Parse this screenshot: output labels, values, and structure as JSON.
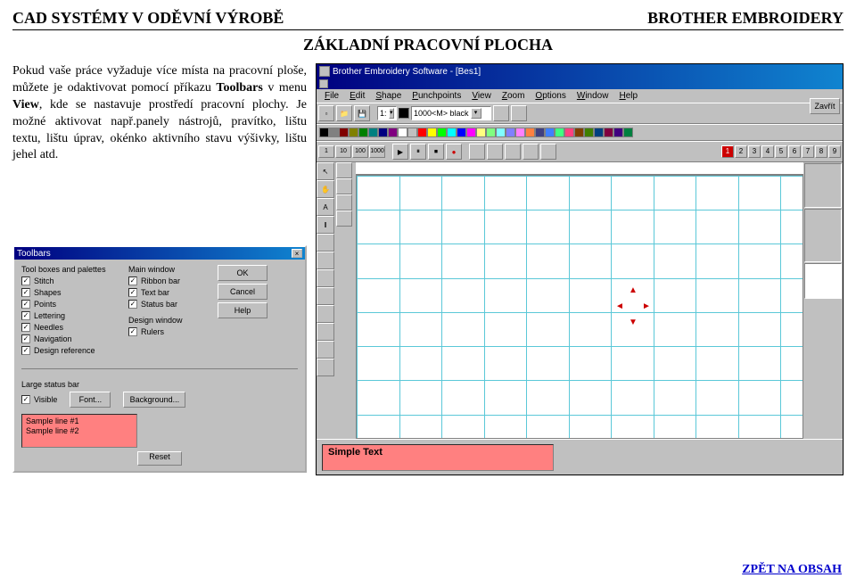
{
  "header": {
    "left": "CAD SYSTÉMY V ODĚVNÍ VÝROBĚ",
    "right": "BROTHER EMBROIDERY",
    "subtitle": "ZÁKLADNÍ PRACOVNÍ PLOCHA"
  },
  "body_text": {
    "p1a": "Pokud vaše práce vyžaduje více místa na pracovní ploše, můžete je odaktivovat pomocí příkazu ",
    "p1b": "Toolbars",
    "p1c": " v menu ",
    "p1d": "View",
    "p1e": ", kde se nastavuje prostředí pracovní plochy. Je možné aktivovat např.panely nástrojů, pravítko, lištu textu, lištu úprav, okénko aktivního stavu výšivky, lištu jehel atd."
  },
  "app": {
    "title": "Brother Embroidery Software - [Bes1]",
    "menu": [
      "File",
      "Edit",
      "Shape",
      "Punchpoints",
      "View",
      "Zoom",
      "Options",
      "Window",
      "Help"
    ],
    "combo_1": "1:",
    "combo_color": "1000<M> black",
    "zavrit": "Zavřít",
    "zoom_buttons": [
      "1",
      "10",
      "100",
      "1000"
    ],
    "number_buttons": [
      "1",
      "2",
      "3",
      "4",
      "5",
      "6",
      "7",
      "8",
      "9"
    ],
    "simple_text": "Simple Text"
  },
  "dialog": {
    "title": "Toolbars",
    "groups": {
      "toolboxes": {
        "title": "Tool boxes and palettes",
        "items": [
          "Stitch",
          "Shapes",
          "Points",
          "Lettering",
          "Needles",
          "Navigation",
          "Design reference"
        ],
        "checked": [
          true,
          true,
          true,
          true,
          true,
          true,
          true
        ]
      },
      "mainwindow": {
        "title": "Main window",
        "items": [
          "Ribbon bar",
          "Text bar",
          "Status bar"
        ],
        "checked": [
          true,
          true,
          true
        ]
      },
      "designwindow": {
        "title": "Design window",
        "items": [
          "Rulers"
        ],
        "checked": [
          true
        ]
      },
      "largestatus": {
        "title": "Large status bar",
        "visible_label": "Visible",
        "visible_checked": true,
        "font_btn": "Font...",
        "bg_btn": "Background..."
      }
    },
    "buttons": {
      "ok": "OK",
      "cancel": "Cancel",
      "help": "Help"
    },
    "sample": {
      "line1": "Sample line #1",
      "line2": "Sample line #2"
    },
    "reset": "Reset"
  },
  "colors": [
    "#000000",
    "#808080",
    "#800000",
    "#808000",
    "#008000",
    "#008080",
    "#000080",
    "#800080",
    "#ffffff",
    "#c0c0c0",
    "#ff0000",
    "#ffff00",
    "#00ff00",
    "#00ffff",
    "#0000ff",
    "#ff00ff",
    "#ffff80",
    "#80ff80",
    "#80ffff",
    "#8080ff",
    "#ff80ff",
    "#ff8040",
    "#404080",
    "#4080ff",
    "#40ff80",
    "#ff4080",
    "#804000",
    "#408000",
    "#004080",
    "#800040",
    "#400080",
    "#008040"
  ],
  "footer_link": "ZPĚT NA OBSAH"
}
